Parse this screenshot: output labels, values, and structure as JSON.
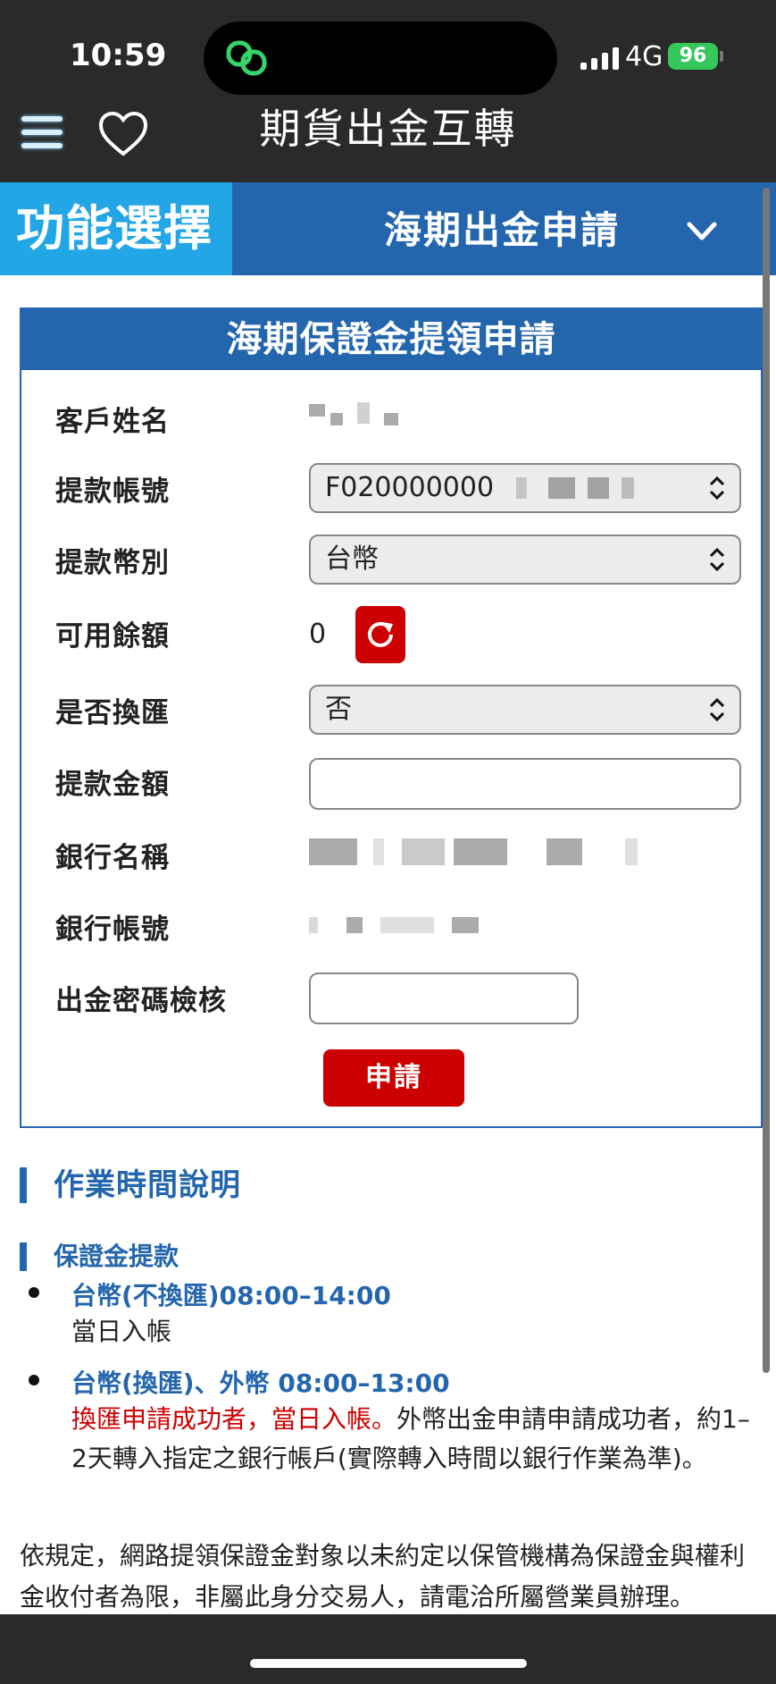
{
  "status_bar": {
    "time": "10:59",
    "network": "4G",
    "battery": "96"
  },
  "header": {
    "title": "期貨出金互轉"
  },
  "function_bar": {
    "label": "功能選擇",
    "selected": "海期出金申請"
  },
  "form": {
    "title": "海期保證金提領申請",
    "customer_name_label": "客戶姓名",
    "account_label": "提款帳號",
    "account_value": "F020000000",
    "currency_label": "提款幣別",
    "currency_value": "台幣",
    "balance_label": "可用餘額",
    "balance_value": "0",
    "exchange_label": "是否換匯",
    "exchange_value": "否",
    "amount_label": "提款金額",
    "bank_name_label": "銀行名稱",
    "bank_account_label": "銀行帳號",
    "password_label": "出金密碼檢核",
    "submit_label": "申請"
  },
  "info": {
    "section_title": "作業時間說明",
    "sub_title": "保證金提款",
    "items": [
      {
        "head": "台幣(不換匯)08:00–14:00",
        "text": "當日入帳"
      },
      {
        "head": "台幣(換匯)、外幣 08:00–13:00",
        "text_red": "換匯申請成功者，當日入帳。",
        "text": "外幣出金申請申請成功者，約1–2天轉入指定之銀行帳戶(實際轉入時間以銀行作業為準)。"
      }
    ],
    "note": "依規定，網路提領保證金對象以未約定以保管機構為保證金與權利金收付者為限，非屬此身分交易人，請電洽所屬營業員辦理。"
  }
}
